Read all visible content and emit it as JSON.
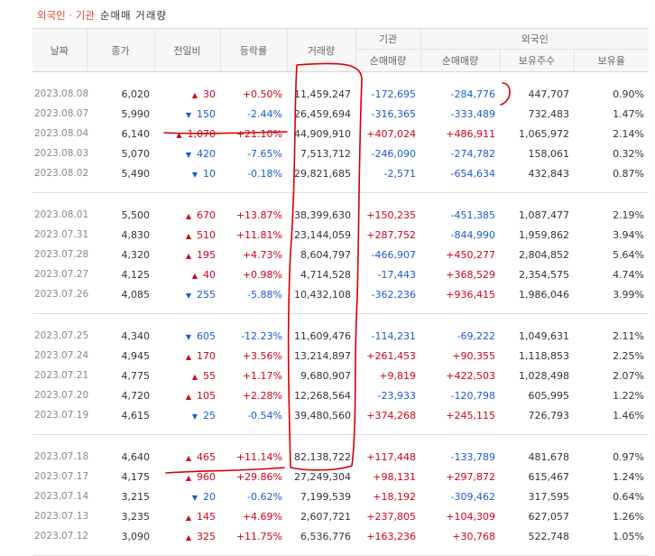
{
  "header": {
    "tab_foreign": "외국인",
    "separator": " · ",
    "tab_institution": "기관",
    "label": "순매매 거래량"
  },
  "columns": {
    "date": "날짜",
    "close": "종가",
    "change": "전일비",
    "rate": "등락률",
    "volume": "거래량",
    "institution_group": "기관",
    "foreign_group": "외국인",
    "inst_net": "순매매량",
    "foreign_net": "순매매량",
    "holdings": "보유주수",
    "hold_ratio": "보유율"
  },
  "colors": {
    "up": "#d0021b",
    "down": "#1a5dc9",
    "annotation": "#d40000"
  },
  "rows": [
    {
      "date": "2023.08.08",
      "close": "6,020",
      "dir": "up",
      "change": "30",
      "rate": "+0.50%",
      "volume": "11,459,247",
      "inst": "-172,695",
      "foreign": "-284,776",
      "holdings": "447,707",
      "ratio": "0.90%"
    },
    {
      "date": "2023.08.07",
      "close": "5,990",
      "dir": "down",
      "change": "150",
      "rate": "-2.44%",
      "volume": "26,459,694",
      "inst": "-316,365",
      "foreign": "-333,489",
      "holdings": "732,483",
      "ratio": "1.47%"
    },
    {
      "date": "2023.08.04",
      "close": "6,140",
      "dir": "up",
      "change": "1,070",
      "rate": "+21.10%",
      "volume": "44,909,910",
      "inst": "+407,024",
      "foreign": "+486,911",
      "holdings": "1,065,972",
      "ratio": "2.14%"
    },
    {
      "date": "2023.08.03",
      "close": "5,070",
      "dir": "down",
      "change": "420",
      "rate": "-7.65%",
      "volume": "7,513,712",
      "inst": "-246,090",
      "foreign": "-274,782",
      "holdings": "158,061",
      "ratio": "0.32%"
    },
    {
      "date": "2023.08.02",
      "close": "5,490",
      "dir": "down",
      "change": "10",
      "rate": "-0.18%",
      "volume": "29,821,685",
      "inst": "-2,571",
      "foreign": "-654,634",
      "holdings": "432,843",
      "ratio": "0.87%"
    },
    {
      "date": "2023.08.01",
      "close": "5,500",
      "dir": "up",
      "change": "670",
      "rate": "+13.87%",
      "volume": "38,399,630",
      "inst": "+150,235",
      "foreign": "-451,385",
      "holdings": "1,087,477",
      "ratio": "2.19%"
    },
    {
      "date": "2023.07.31",
      "close": "4,830",
      "dir": "up",
      "change": "510",
      "rate": "+11.81%",
      "volume": "23,144,059",
      "inst": "+287,752",
      "foreign": "-844,990",
      "holdings": "1,959,862",
      "ratio": "3.94%"
    },
    {
      "date": "2023.07.28",
      "close": "4,320",
      "dir": "up",
      "change": "195",
      "rate": "+4.73%",
      "volume": "8,604,797",
      "inst": "-466,907",
      "foreign": "+450,277",
      "holdings": "2,804,852",
      "ratio": "5.64%"
    },
    {
      "date": "2023.07.27",
      "close": "4,125",
      "dir": "up",
      "change": "40",
      "rate": "+0.98%",
      "volume": "4,714,528",
      "inst": "-17,443",
      "foreign": "+368,529",
      "holdings": "2,354,575",
      "ratio": "4.74%"
    },
    {
      "date": "2023.07.26",
      "close": "4,085",
      "dir": "down",
      "change": "255",
      "rate": "-5.88%",
      "volume": "10,432,108",
      "inst": "-362,236",
      "foreign": "+936,415",
      "holdings": "1,986,046",
      "ratio": "3.99%"
    },
    {
      "date": "2023.07.25",
      "close": "4,340",
      "dir": "down",
      "change": "605",
      "rate": "-12.23%",
      "volume": "11,609,476",
      "inst": "-114,231",
      "foreign": "-69,222",
      "holdings": "1,049,631",
      "ratio": "2.11%"
    },
    {
      "date": "2023.07.24",
      "close": "4,945",
      "dir": "up",
      "change": "170",
      "rate": "+3.56%",
      "volume": "13,214,897",
      "inst": "+261,453",
      "foreign": "+90,355",
      "holdings": "1,118,853",
      "ratio": "2.25%"
    },
    {
      "date": "2023.07.21",
      "close": "4,775",
      "dir": "up",
      "change": "55",
      "rate": "+1.17%",
      "volume": "9,680,907",
      "inst": "+9,819",
      "foreign": "+422,503",
      "holdings": "1,028,498",
      "ratio": "2.07%"
    },
    {
      "date": "2023.07.20",
      "close": "4,720",
      "dir": "up",
      "change": "105",
      "rate": "+2.28%",
      "volume": "12,268,564",
      "inst": "-23,933",
      "foreign": "-120,798",
      "holdings": "605,995",
      "ratio": "1.22%"
    },
    {
      "date": "2023.07.19",
      "close": "4,615",
      "dir": "down",
      "change": "25",
      "rate": "-0.54%",
      "volume": "39,480,560",
      "inst": "+374,268",
      "foreign": "+245,115",
      "holdings": "726,793",
      "ratio": "1.46%"
    },
    {
      "date": "2023.07.18",
      "close": "4,640",
      "dir": "up",
      "change": "465",
      "rate": "+11.14%",
      "volume": "82,138,722",
      "inst": "+117,448",
      "foreign": "-133,789",
      "holdings": "481,678",
      "ratio": "0.97%"
    },
    {
      "date": "2023.07.17",
      "close": "4,175",
      "dir": "up",
      "change": "960",
      "rate": "+29.86%",
      "volume": "27,249,304",
      "inst": "+98,131",
      "foreign": "+297,872",
      "holdings": "615,467",
      "ratio": "1.24%"
    },
    {
      "date": "2023.07.14",
      "close": "3,215",
      "dir": "down",
      "change": "20",
      "rate": "-0.62%",
      "volume": "7,199,539",
      "inst": "+18,192",
      "foreign": "-309,462",
      "holdings": "317,595",
      "ratio": "0.64%"
    },
    {
      "date": "2023.07.13",
      "close": "3,235",
      "dir": "up",
      "change": "145",
      "rate": "+4.69%",
      "volume": "2,607,721",
      "inst": "+237,805",
      "foreign": "+104,309",
      "holdings": "627,057",
      "ratio": "1.26%"
    },
    {
      "date": "2023.07.12",
      "close": "3,090",
      "dir": "up",
      "change": "325",
      "rate": "+11.75%",
      "volume": "6,536,776",
      "inst": "+163,236",
      "foreign": "+30,768",
      "holdings": "522,748",
      "ratio": "1.05%"
    }
  ]
}
